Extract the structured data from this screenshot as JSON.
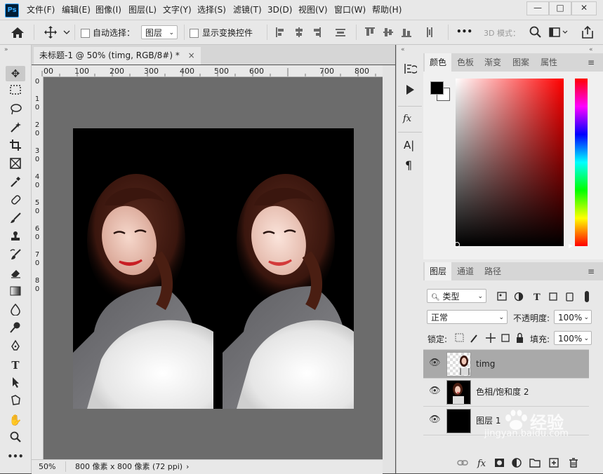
{
  "app": {
    "logo": "Ps"
  },
  "menu": [
    "文件(F)",
    "编辑(E)",
    "图像(I)",
    "图层(L)",
    "文字(Y)",
    "选择(S)",
    "滤镜(T)",
    "3D(D)",
    "视图(V)",
    "窗口(W)",
    "帮助(H)"
  ],
  "window_controls": {
    "minimize": "—",
    "maximize": "□",
    "close": "✕"
  },
  "options_bar": {
    "auto_select_label": "自动选择：",
    "auto_select_value": "图层",
    "show_transform_label": "显示变换控件",
    "mode_3d_label": "3D 模式：",
    "more": "•••"
  },
  "document": {
    "tab_title": "未标题-1 @ 50% (timg, RGB/8#) *",
    "tab_close": "×",
    "ruler_h_ticks": [
      "00",
      "100",
      "200",
      "300",
      "400",
      "500",
      "600",
      "700",
      "800"
    ],
    "ruler_v_ticks": [
      "0",
      "1",
      "0",
      "2",
      "0",
      "3",
      "0",
      "4",
      "0",
      "5",
      "0",
      "6",
      "0",
      "7",
      "0",
      "8",
      "0"
    ],
    "zoom": "50%",
    "doc_info": "800 像素 x 800 像素 (72 ppi)",
    "status_arrow": "›"
  },
  "tools": [
    "move-tool",
    "marquee-tool",
    "lasso-tool",
    "magic-wand-tool",
    "crop-tool",
    "frame-tool",
    "eyedropper-tool",
    "healing-tool",
    "brush-tool",
    "stamp-tool",
    "history-brush-tool",
    "eraser-tool",
    "gradient-tool",
    "blur-tool",
    "dodge-tool",
    "pen-tool",
    "type-tool",
    "path-select-tool",
    "shape-tool",
    "hand-tool",
    "zoom-tool",
    "more-tools"
  ],
  "middle_dock": {
    "text_a": "A|",
    "para": "¶",
    "fx": "fx"
  },
  "color_panel": {
    "tabs": [
      "颜色",
      "色板",
      "渐变",
      "图案",
      "属性"
    ],
    "active_tab": "颜色",
    "foreground": "#000000",
    "background": "#ffffff",
    "hue": "#ff0000"
  },
  "layers_panel": {
    "tabs": [
      "图层",
      "通道",
      "路径"
    ],
    "active_tab": "图层",
    "filter_label": "类型",
    "blend_mode": "正常",
    "opacity_label": "不透明度:",
    "opacity_value": "100%",
    "lock_label": "锁定:",
    "fill_label": "填充:",
    "fill_value": "100%",
    "layers": [
      {
        "name": "timg",
        "selected": true
      },
      {
        "name": "色相/饱和度 2",
        "selected": false
      },
      {
        "name": "图层 1",
        "selected": false
      }
    ],
    "footer_icons": [
      "link-icon",
      "fx-icon",
      "mask-icon",
      "adjustment-icon",
      "folder-icon",
      "new-layer-icon",
      "trash-icon"
    ]
  },
  "watermark": {
    "text": "经验",
    "url": "jingyan.baidu.com"
  }
}
